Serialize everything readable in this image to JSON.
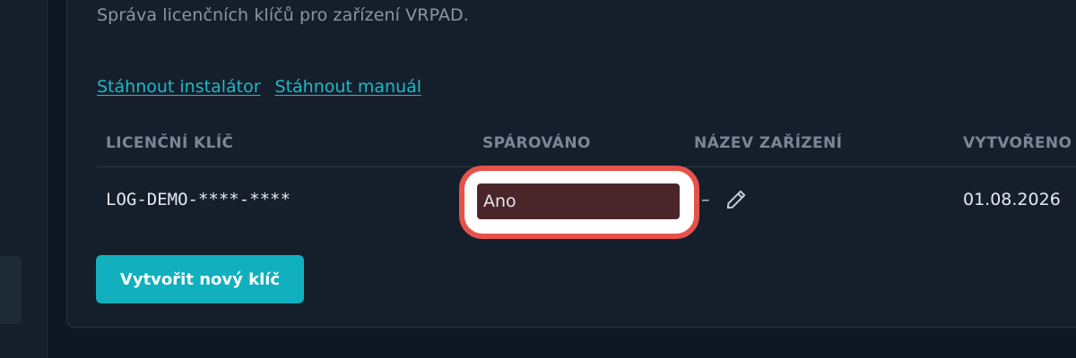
{
  "page": {
    "subtitle": "Správa licenčních klíčů pro zařízení VRPAD."
  },
  "links": {
    "installer": "Stáhnout instalátor",
    "manual": "Stáhnout manuál"
  },
  "table": {
    "headers": [
      "LICENČNÍ KLÍČ",
      "SPÁROVÁNO",
      "NÁZEV ZAŘÍZENÍ",
      "VYTVOŘENO"
    ],
    "rows": [
      {
        "license_key": "LOG-DEMO-****-****",
        "paired": "Ano",
        "device_name": "–",
        "created": "01.08.2026"
      }
    ]
  },
  "actions": {
    "create_label": "Vytvořit nový klíč"
  },
  "colors": {
    "accent": "#10b0bf",
    "highlight": "#e5524a"
  }
}
